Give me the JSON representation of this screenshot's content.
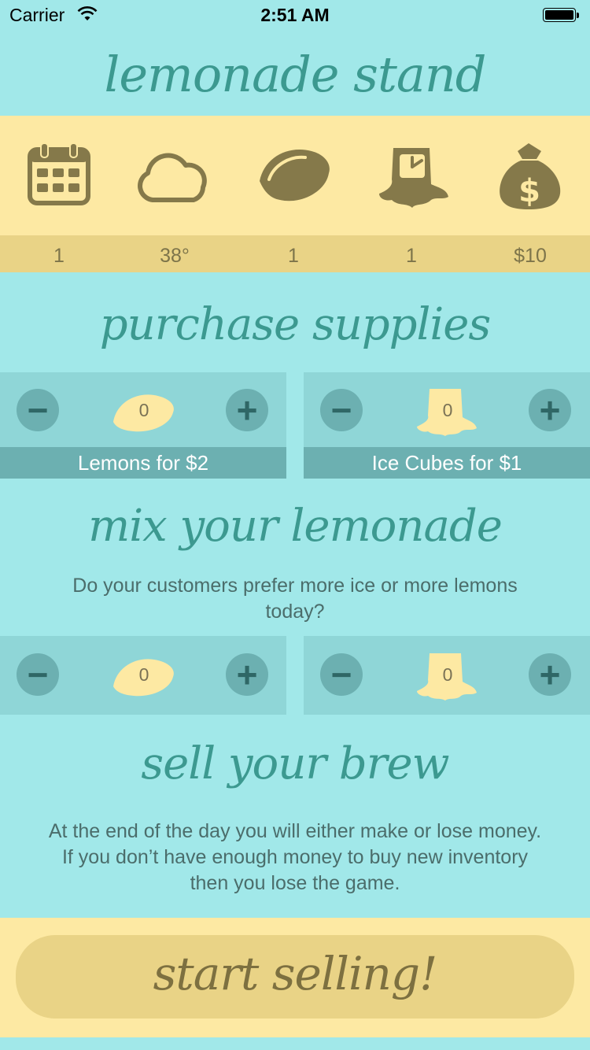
{
  "status_bar": {
    "carrier": "Carrier",
    "time": "2:51 AM"
  },
  "title": "lemonade stand",
  "stats": [
    {
      "icon": "calendar-icon",
      "value": "1"
    },
    {
      "icon": "cloud-icon",
      "value": "38°"
    },
    {
      "icon": "lemon-icon",
      "value": "1"
    },
    {
      "icon": "ice-cube-icon",
      "value": "1"
    },
    {
      "icon": "money-bag-icon",
      "value": "$10"
    }
  ],
  "purchase": {
    "heading": "purchase supplies",
    "lemons": {
      "count": "0",
      "label": "Lemons for $2"
    },
    "ice": {
      "count": "0",
      "label": "Ice Cubes for $1"
    }
  },
  "mix": {
    "heading": "mix your lemonade",
    "text": "Do your customers prefer more ice or more lemons today?",
    "lemons": {
      "count": "0"
    },
    "ice": {
      "count": "0"
    }
  },
  "sell": {
    "heading": "sell your brew",
    "text": "At the end of the day you will either make or lose money. If you don’t have enough money to buy new inventory then you lose the game."
  },
  "start_button": "start selling!",
  "colors": {
    "background": "#a1e8e9",
    "yellow_band": "#fde9a3",
    "yellow_dark": "#e9d386",
    "teal_panel": "#8fd6d7",
    "teal_dark": "#6cb0b1",
    "heading": "#3c9990",
    "icon": "#85794a"
  }
}
